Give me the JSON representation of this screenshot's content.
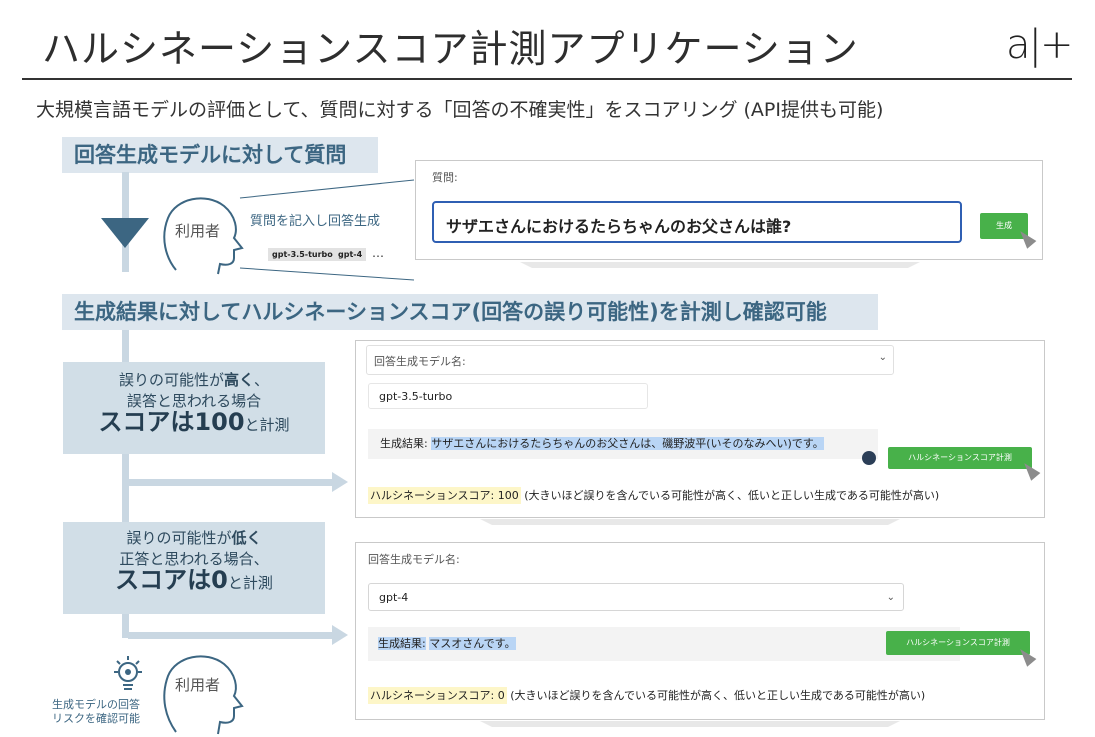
{
  "header": {
    "title": "ハルシネーションスコア計測アプリケーション",
    "logo": "a|+",
    "subtitle": "大規模言語モデルの評価として、質問に対する「回答の不確実性」をスコアリング (API提供も可能)"
  },
  "section1": {
    "title": "回答生成モデルに対して質問",
    "user_label": "利用者",
    "action_label": "質問を記入し回答生成",
    "model_chips": [
      "gpt-3.5-turbo",
      "gpt-4"
    ],
    "chip_more": "…",
    "panel": {
      "question_label": "質問:",
      "question_value": "サザエさんにおけるたらちゃんのお父さんは誰?",
      "generate_button": "生成"
    }
  },
  "section2": {
    "title": "生成結果に対してハルシネーションスコア(回答の誤り可能性)を計測し確認可能",
    "info_high": {
      "line1_pre": "誤りの可能性が",
      "line1_strong": "高く",
      "line1_post": "、",
      "line2": "誤答と思われる場合",
      "line3_big": "スコアは100",
      "line3_small": "と計測"
    },
    "info_low": {
      "line1_pre": "誤りの可能性が",
      "line1_strong": "低く",
      "line2": "正答と思われる場合、",
      "line3_big": "スコアは0",
      "line3_small": "と計測"
    },
    "panel_high": {
      "model_label": "回答生成モデル名:",
      "model_value": "gpt-3.5-turbo",
      "result_label": "生成結果:",
      "result_value": "サザエさんにおけるたらちゃんのお父さんは、磯野波平(いそのなみへい)です。",
      "measure_button": "ハルシネーションスコア計測",
      "score_label": "ハルシネーションスコア:",
      "score_value": "100",
      "score_note": "(大きいほど誤りを含んでいる可能性が高く、低いと正しい生成である可能性が高い)"
    },
    "panel_low": {
      "model_label": "回答生成モデル名:",
      "model_value": "gpt-4",
      "result_label": "生成結果:",
      "result_value": "マスオさんです。",
      "measure_button": "ハルシネーションスコア計測",
      "score_label": "ハルシネーションスコア:",
      "score_value": "0",
      "score_note": "(大きいほど誤りを含んでいる可能性が高く、低いと正しい生成である可能性が高い)"
    },
    "user_label": "利用者",
    "user_caption_line1": "生成モデルの回答",
    "user_caption_line2": "リスクを確認可能"
  },
  "colors": {
    "accent": "#3c6682",
    "section_bg": "#dde6ee",
    "info_bg": "#d1dee7",
    "button_green": "#48b14a",
    "result_highlight": "#b9d5f5",
    "score_highlight": "#fdf6c8"
  }
}
